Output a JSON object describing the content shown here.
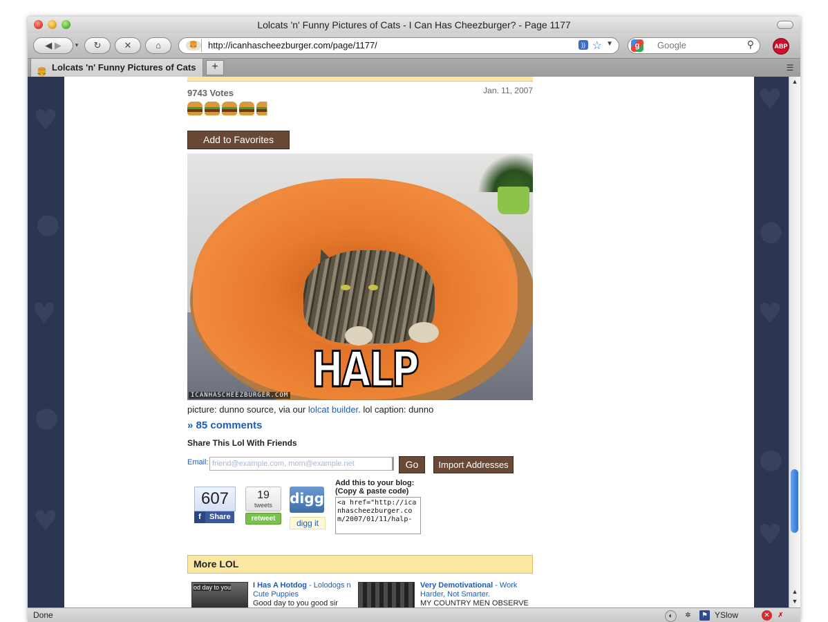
{
  "window": {
    "title": "Lolcats 'n' Funny Pictures of Cats - I Can Has Cheezburger? - Page 1177"
  },
  "toolbar": {
    "url": "http://icanhascheezburger.com/page/1177/",
    "search_placeholder": "Google",
    "adblock_label": "ABP"
  },
  "tabs": [
    {
      "label": "Lolcats 'n' Funny Pictures of Cats ..."
    }
  ],
  "post": {
    "votes": "9743 Votes",
    "date": "Jan. 11, 2007",
    "rating_burgers": 4.6,
    "favorites_label": "Add to Favorites",
    "image_caption": "HALP",
    "watermark": "ICANHASCHEEZBURGER.COM",
    "caption_prefix": "picture: dunno source, via our ",
    "caption_link": "lolcat builder",
    "caption_suffix": ". lol caption: dunno",
    "comments": "» 85 comments"
  },
  "share": {
    "title": "Share This Lol With Friends",
    "email_label": "Email:",
    "email_placeholder": "friend@example.com, mom@example.net",
    "go_label": "Go",
    "import_label": "Import Addresses",
    "facebook_count": "607",
    "facebook_label": "Share",
    "tweets_count": "19",
    "tweets_label": "tweets",
    "retweet_label": "retweet",
    "digg_logo": "digg",
    "digg_label": "digg it",
    "blog_title": "Add this to your blog: (Copy & paste code)",
    "blog_code": "<a href=\"http://icanhascheezburger.com/2007/01/11/halp-"
  },
  "more_lol": {
    "title": "More LOL",
    "items": [
      {
        "title": "I Has A Hotdog",
        "desc": " - Lolodogs n Cute Puppies",
        "snippet": "Good day to you good sir",
        "thumb_caption": "od day to you"
      },
      {
        "title": "Very Demotivational",
        "desc": " - Work Harder, Not Smarter.",
        "snippet": "MY COUNTRY MEN OBSERVE ME"
      }
    ]
  },
  "status": {
    "text": "Done",
    "yslow": "YSlow"
  },
  "colors": {
    "accent_brown": "#6a4836",
    "link_blue": "#1d5cb8",
    "band_yellow": "#fae7a2",
    "page_bg_navy": "#2c3552"
  }
}
